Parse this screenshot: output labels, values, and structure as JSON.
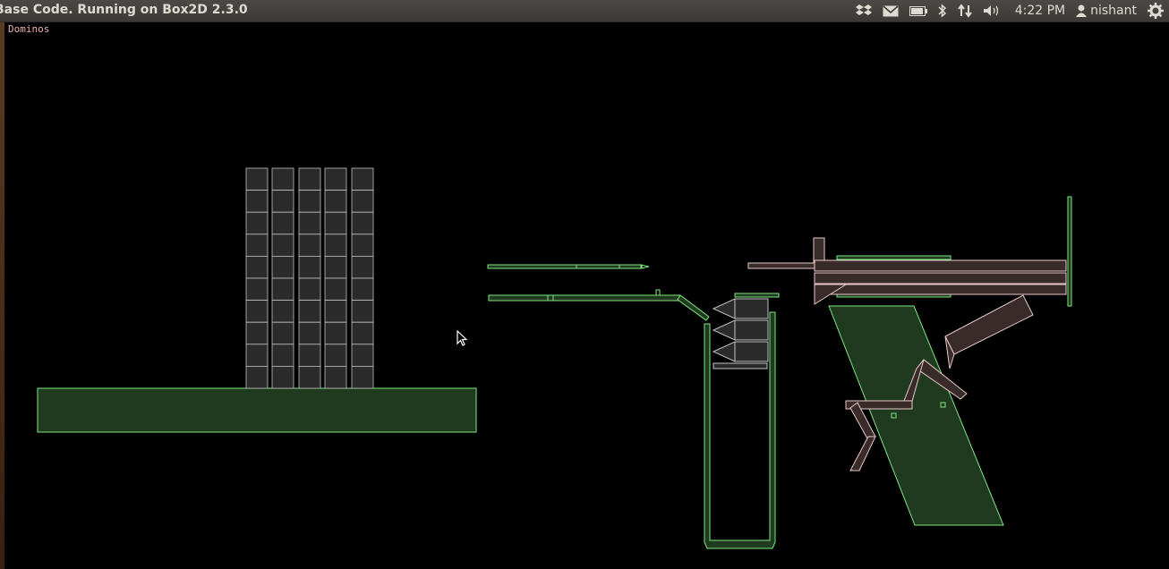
{
  "window": {
    "title": "Base Code. Running on Box2D 2.3.0"
  },
  "scene_label": "Dominos",
  "tray": {
    "icons": [
      "dropbox-icon",
      "mail-icon",
      "battery-icon",
      "bluetooth-icon",
      "network-icon",
      "volume-icon"
    ],
    "clock": "4:22 PM",
    "user": "nishant",
    "power_icon": "gear-icon"
  },
  "colors": {
    "static_outline": "#7ee87e",
    "static_fill": "#1f3a1f",
    "dynamic_outline": "#e8c8c8",
    "dynamic_fill": "#3a2b2b",
    "box_outline": "#c0c0c0",
    "box_fill": "#2b2b2b"
  }
}
